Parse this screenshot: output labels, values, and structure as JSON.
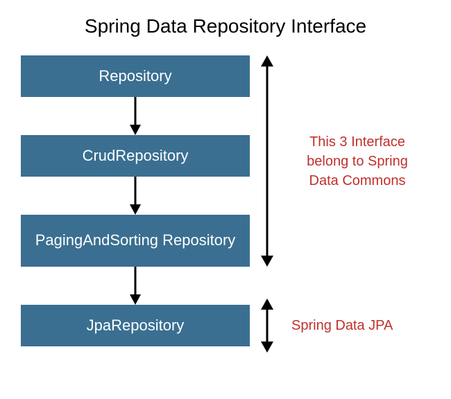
{
  "title": "Spring Data Repository Interface",
  "boxes": {
    "repository": "Repository",
    "crud": "CrudRepository",
    "paging": "PagingAndSorting Repository",
    "jpa": "JpaRepository"
  },
  "annotations": {
    "commons": "This 3 Interface belong to Spring Data Commons",
    "jpa": "Spring Data JPA"
  },
  "colors": {
    "box_bg": "#3a6f91",
    "box_text": "#ffffff",
    "annotation_text": "#c0302b",
    "arrow": "#000000"
  }
}
